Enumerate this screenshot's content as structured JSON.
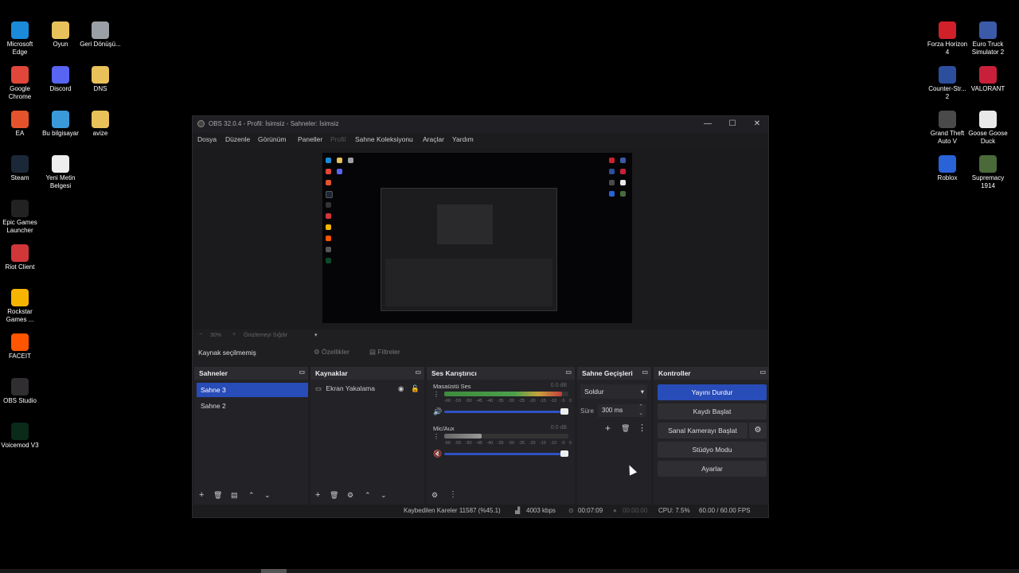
{
  "desktop": {
    "left_icons": [
      {
        "label": "Microsoft Edge",
        "icon": "edge-icon",
        "color": "#1b8ad8"
      },
      {
        "label": "Oyun",
        "icon": "folder-icon",
        "color": "#e8c15a"
      },
      {
        "label": "Geri Dönüşü...",
        "icon": "recycle-bin-icon",
        "color": "#9aa0a6"
      },
      {
        "label": "Google Chrome",
        "icon": "chrome-icon",
        "color": "#e0463a"
      },
      {
        "label": "Discord",
        "icon": "discord-icon",
        "color": "#5865f2"
      },
      {
        "label": "DNS",
        "icon": "folder-icon",
        "color": "#e8c15a"
      },
      {
        "label": "EA",
        "icon": "ea-icon",
        "color": "#e5532d"
      },
      {
        "label": "Bu bilgisayar",
        "icon": "computer-icon",
        "color": "#3a9ad9"
      },
      {
        "label": "avize",
        "icon": "folder-icon",
        "color": "#e8c15a"
      },
      {
        "label": "Steam",
        "icon": "steam-icon",
        "color": "#1b2838"
      },
      {
        "label": "Yeni Metin Belgesi",
        "icon": "text-file-icon",
        "color": "#eeeeee"
      },
      {
        "label": "Epic Games Launcher",
        "icon": "epic-icon",
        "color": "#222222"
      },
      {
        "label": "Riot Client",
        "icon": "riot-icon",
        "color": "#d13639"
      },
      {
        "label": "Rockstar Games ...",
        "icon": "rockstar-icon",
        "color": "#f5b400"
      },
      {
        "label": "FACEIT",
        "icon": "faceit-icon",
        "color": "#ff5500"
      },
      {
        "label": "OBS Studio",
        "icon": "obs-icon",
        "color": "#302e31"
      },
      {
        "label": "Voicemod V3",
        "icon": "voicemod-icon",
        "color": "#0a2a1a"
      }
    ],
    "right_icons": [
      {
        "label": "Forza Horizon 4",
        "icon": "forza-icon",
        "color": "#d0202a"
      },
      {
        "label": "Euro Truck Simulator 2",
        "icon": "ets2-icon",
        "color": "#3b5aa8"
      },
      {
        "label": "Counter-Str... 2",
        "icon": "cs2-icon",
        "color": "#2b4f9c"
      },
      {
        "label": "VALORANT",
        "icon": "valorant-icon",
        "color": "#c8203a"
      },
      {
        "label": "Grand Theft Auto V",
        "icon": "gta-icon",
        "color": "#4a4a4a"
      },
      {
        "label": "Goose Goose Duck",
        "icon": "goose-icon",
        "color": "#e8e8e8"
      },
      {
        "label": "Roblox",
        "icon": "roblox-icon",
        "color": "#2a62d8"
      },
      {
        "label": "Supremacy 1914",
        "icon": "supremacy-icon",
        "color": "#4a6a3a"
      }
    ]
  },
  "window": {
    "title": "OBS 32.0.4 - Profil: İsimsiz - Sahneler: İsimsiz",
    "minimize": "—",
    "maximize": "☐",
    "close": "✕"
  },
  "menu": [
    "Dosya",
    "Düzenle",
    "Görünüm",
    "Paneller",
    "Profil",
    "Sahne Koleksiyonu",
    "Araçlar",
    "Yardım"
  ],
  "zoom": {
    "value": "30%",
    "label": "Önizlemeyi Sığdır"
  },
  "source_status": {
    "label": "Kaynak seçilmemiş",
    "properties": "Özellikler",
    "filters": "Filtreler"
  },
  "scenes": {
    "title": "Sahneler",
    "items": [
      "Sahne 3",
      "Sahne 2"
    ],
    "selected": "Sahne 3"
  },
  "sources": {
    "title": "Kaynaklar",
    "items": [
      "Ekran Yakalama"
    ]
  },
  "mixer": {
    "title": "Ses Karıştırıcı",
    "channels": [
      {
        "name": "Masaüstü Ses",
        "db": "0.0 dB",
        "level": 0.95
      },
      {
        "name": "Mic/Aux",
        "db": "0.0 dB",
        "level": 0.3
      }
    ],
    "scale": [
      "-60",
      "-55",
      "-50",
      "-45",
      "-40",
      "-35",
      "-30",
      "-25",
      "-20",
      "-15",
      "-10",
      "-5",
      "0"
    ]
  },
  "transitions": {
    "title": "Sahne Geçişleri",
    "type": "Soldur",
    "duration_label": "Süre",
    "duration": "300 ms"
  },
  "controls": {
    "title": "Kontroller",
    "buttons": [
      "Yayını Durdur",
      "Kaydı Başlat",
      "Sanal Kamerayı Başlat",
      "Stüdyo Modu",
      "Ayarlar"
    ]
  },
  "statusbar": {
    "dropped": "Kaybedilen Kareler 11587 (%45.1)",
    "bitrate": "4003 kbps",
    "stream_time": "00:07:09",
    "rec_time": "00:00:00",
    "cpu": "CPU: 7.5%",
    "fps": "60.00 / 60.00 FPS"
  },
  "colors": {
    "accent": "#284cb8",
    "panel": "#232327",
    "window_bg": "#1f1f22"
  }
}
